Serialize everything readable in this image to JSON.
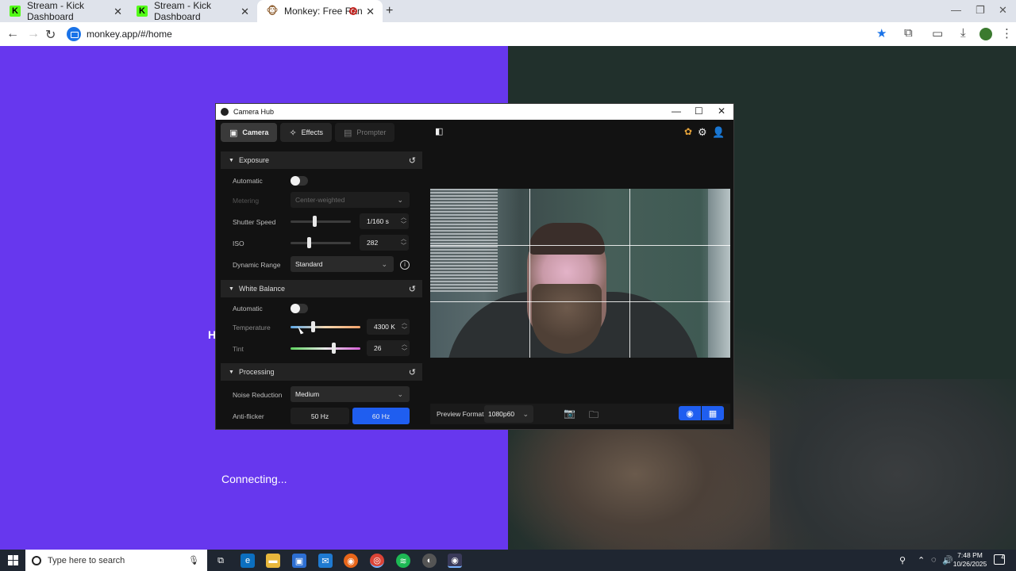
{
  "browser": {
    "tabs": [
      {
        "title": "Stream - Kick Dashboard",
        "favicon": "kick-icon"
      },
      {
        "title": "Stream - Kick Dashboard",
        "favicon": "kick-icon"
      },
      {
        "title": "Monkey: Free Random Vide",
        "favicon": "monkey-icon",
        "active": true
      }
    ],
    "url": "monkey.app/#/home"
  },
  "page": {
    "status": "Connecting...",
    "partial_letter": "H",
    "left_color": "#6737ee"
  },
  "camera_hub": {
    "title": "Camera Hub",
    "tabs": [
      "Camera",
      "Effects",
      "Prompter"
    ],
    "exposure": {
      "header": "Exposure",
      "automatic_label": "Automatic",
      "metering_label": "Metering",
      "metering_value": "Center-weighted",
      "shutter_label": "Shutter Speed",
      "shutter_value": "1/160 s",
      "iso_label": "ISO",
      "iso_value": "282",
      "dynamic_range_label": "Dynamic Range",
      "dynamic_range_value": "Standard"
    },
    "white_balance": {
      "header": "White Balance",
      "automatic_label": "Automatic",
      "temperature_label": "Temperature",
      "temperature_value": "4300 K",
      "tint_label": "Tint",
      "tint_value": "26"
    },
    "processing": {
      "header": "Processing",
      "noise_label": "Noise Reduction",
      "noise_value": "Medium",
      "antiflicker_label": "Anti-flicker",
      "antiflicker_options": [
        "50 Hz",
        "60 Hz"
      ],
      "antiflicker_selected": "60 Hz"
    },
    "preview_format_label": "Preview Format",
    "preview_format_value": "1080p60",
    "accent": "#1f5ef0"
  },
  "taskbar": {
    "search_placeholder": "Type here to search",
    "time": "7:48 PM",
    "date": "10/26/2025",
    "notifications": "4"
  }
}
